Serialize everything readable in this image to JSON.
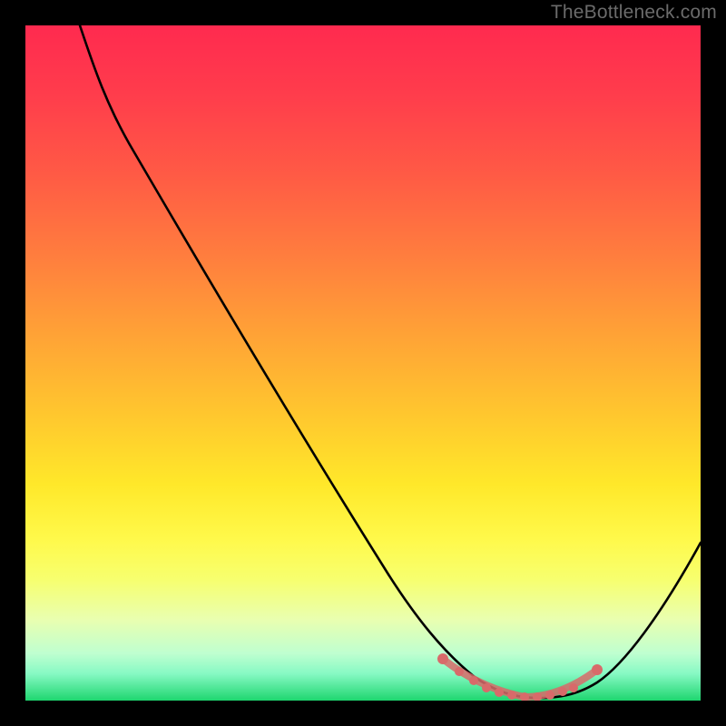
{
  "watermark": "TheBottleneck.com",
  "chart_data": {
    "type": "line",
    "title": "",
    "xlabel": "",
    "ylabel": "",
    "xlim": [
      0,
      100
    ],
    "ylim": [
      0,
      100
    ],
    "series": [
      {
        "name": "bottleneck-curve",
        "x": [
          10,
          14,
          20,
          30,
          40,
          50,
          58,
          63,
          67,
          70,
          73,
          76,
          79,
          82,
          85,
          90,
          95,
          100
        ],
        "values": [
          100,
          94,
          85,
          70,
          55,
          40,
          28,
          20,
          13,
          8,
          4,
          2,
          1,
          1,
          2,
          6,
          14,
          24
        ]
      }
    ],
    "markers": {
      "name": "highlight-region",
      "color": "#d86a6a",
      "x": [
        63,
        66,
        69,
        72,
        74,
        76,
        78,
        80,
        82,
        83,
        85
      ],
      "values": [
        6.5,
        5.0,
        4.0,
        3.2,
        2.8,
        2.5,
        2.5,
        2.7,
        3.2,
        3.8,
        5.8
      ]
    }
  }
}
